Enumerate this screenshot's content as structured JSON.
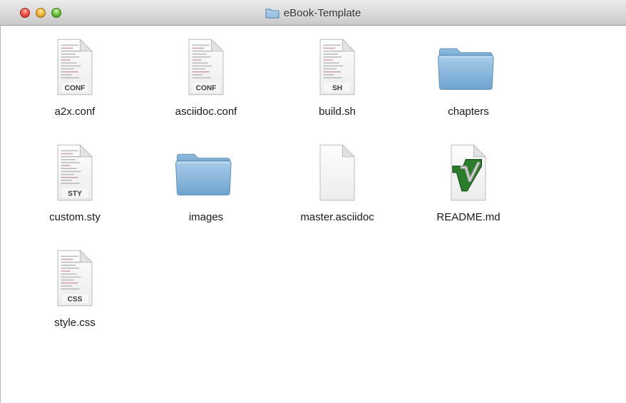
{
  "window": {
    "title": "eBook-Template",
    "title_icon": "folder-icon",
    "controls": [
      "close",
      "minimize",
      "zoom"
    ]
  },
  "colors": {
    "folder": "#7fb2d9",
    "close": "#f2574c",
    "minimize": "#f7bb3b",
    "zoom": "#6fc43f"
  },
  "items": [
    {
      "name": "a2x.conf",
      "kind": "document",
      "badge": "CONF",
      "icon": "conf-file-icon"
    },
    {
      "name": "asciidoc.conf",
      "kind": "document",
      "badge": "CONF",
      "icon": "conf-file-icon"
    },
    {
      "name": "build.sh",
      "kind": "document",
      "badge": "SH",
      "icon": "shell-script-icon"
    },
    {
      "name": "chapters",
      "kind": "folder",
      "badge": "",
      "icon": "folder-icon"
    },
    {
      "name": "custom.sty",
      "kind": "document",
      "badge": "STY",
      "icon": "sty-file-icon"
    },
    {
      "name": "images",
      "kind": "folder",
      "badge": "",
      "icon": "folder-icon"
    },
    {
      "name": "master.asciidoc",
      "kind": "blank",
      "badge": "",
      "icon": "blank-document-icon"
    },
    {
      "name": "README.md",
      "kind": "vim",
      "badge": "",
      "icon": "vim-document-icon"
    },
    {
      "name": "style.css",
      "kind": "document",
      "badge": "CSS",
      "icon": "css-file-icon"
    }
  ]
}
